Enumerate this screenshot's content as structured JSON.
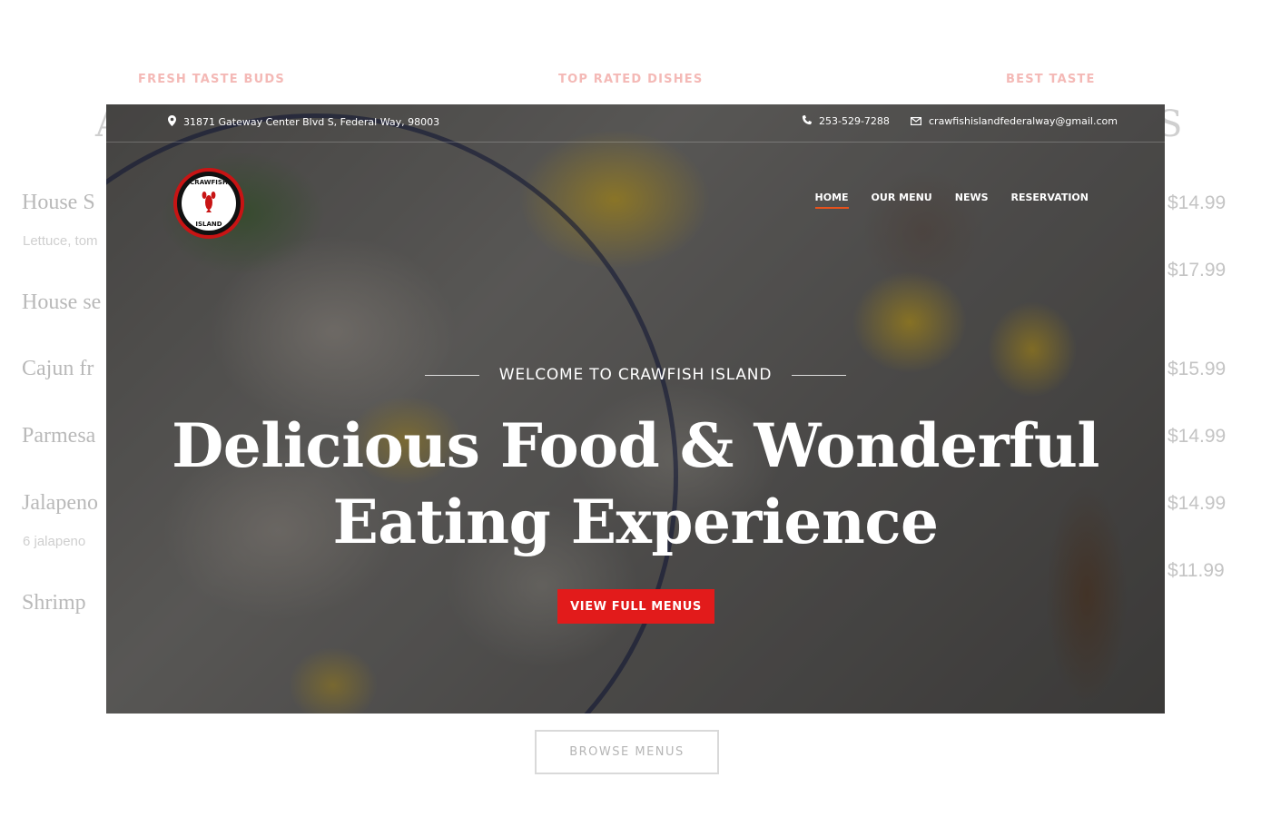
{
  "background_page": {
    "tags": [
      "FRESH TASTE BUDS",
      "TOP RATED DISHES",
      "BEST TASTE"
    ],
    "big_letters": [
      "A",
      "S"
    ],
    "menu_items": [
      {
        "name": "House S",
        "sub": "Lettuce, tom"
      },
      {
        "name": "House se",
        "sub": ""
      },
      {
        "name": "Cajun fr",
        "sub": ""
      },
      {
        "name": "Parmesa",
        "sub": ""
      },
      {
        "name": "Jalapeno",
        "sub": "6 jalapeno"
      },
      {
        "name": "Shrimp",
        "sub": ""
      }
    ],
    "prices": [
      "$14.99",
      "$17.99",
      "$15.99",
      "$14.99",
      "$14.99",
      "$11.99"
    ],
    "browse_label": "BROWSE MENUS"
  },
  "topbar": {
    "address": "31871 Gateway Center Blvd S, Federal Way, 98003",
    "phone": "253-529-7288",
    "email": "crawfishislandfederalway@gmail.com"
  },
  "logo": {
    "top_text": "CRAWFISH",
    "bottom_text": "ISLAND"
  },
  "nav": {
    "items": [
      "HOME",
      "OUR MENU",
      "NEWS",
      "RESERVATION"
    ],
    "active": "HOME"
  },
  "hero": {
    "welcome": "WELCOME TO CRAWFISH ISLAND",
    "headline_line1": "Delicious Food & Wonderful",
    "headline_line2": "Eating Experience",
    "cta_label": "VIEW FULL MENUS"
  },
  "colors": {
    "accent_red": "#e21b1b",
    "nav_underline": "#e8521c",
    "tag_pink": "#f4b9b6"
  },
  "icons": [
    "map-pin-icon",
    "phone-icon",
    "mail-icon"
  ]
}
